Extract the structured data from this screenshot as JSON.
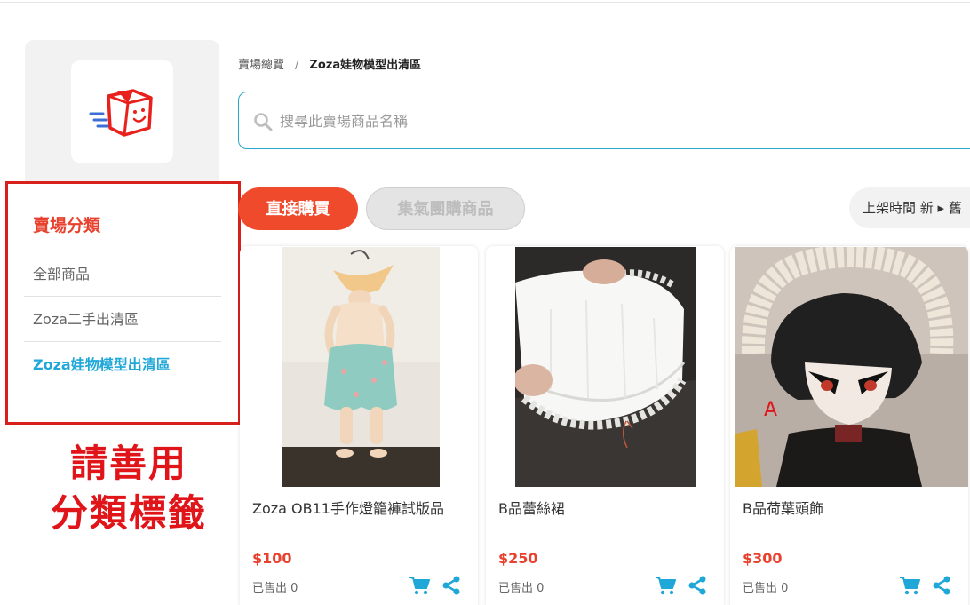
{
  "logo": {
    "icon": "smiling-box-logo"
  },
  "categories": {
    "title": "賣場分類",
    "items": [
      {
        "label": "全部商品"
      },
      {
        "label": "Zoza二手出清區"
      },
      {
        "label": "Zoza娃物模型出清區"
      }
    ]
  },
  "annotation": {
    "line1": "請善用",
    "line2": "分類標籤"
  },
  "breadcrumb": {
    "home": "賣場總覽",
    "separator": "/",
    "current": "Zoza娃物模型出清區"
  },
  "search": {
    "placeholder": "搜尋此賣場商品名稱",
    "value": ""
  },
  "tabs": {
    "buy_now": "直接購買",
    "group_buy": "集氣團購商品"
  },
  "sort": {
    "label": "上架時間 新 ▸ 舊"
  },
  "products": [
    {
      "name": "Zoza OB11手作燈籠褲試版品",
      "price": "$100",
      "sold": "已售出 0"
    },
    {
      "name": "B品蕾絲裙",
      "price": "$250",
      "sold": "已售出 0"
    },
    {
      "name": "B品荷葉頭飾",
      "price": "$300",
      "sold": "已售出 0",
      "photo_mark": "A"
    }
  ],
  "colors": {
    "accent": "#f04a2d",
    "active_category": "#1fa7d8",
    "annotation_red": "#d8201c",
    "icon_blue": "#1fa7d8"
  }
}
